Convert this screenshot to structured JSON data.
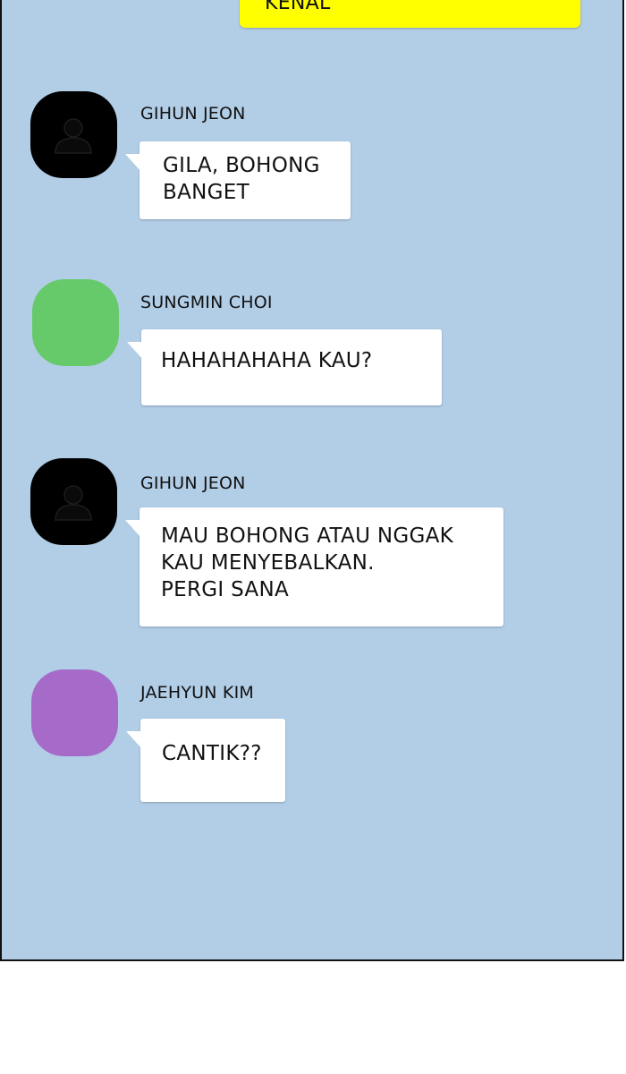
{
  "chat": {
    "own_message": {
      "text": "KENAL",
      "color": "#ffff00"
    },
    "messages": [
      {
        "sender": "GIHUN JEON",
        "avatar_color": "#000000",
        "avatar_icon": "person-icon",
        "text": "GILA, BOHONG\nBANGET"
      },
      {
        "sender": "SUNGMIN CHOI",
        "avatar_color": "#66c96a",
        "text": "HAHAHAHAHA KAU?"
      },
      {
        "sender": "GIHUN JEON",
        "avatar_color": "#000000",
        "avatar_icon": "person-icon",
        "text": "MAU BOHONG ATAU NGGAK\nKAU MENYEBALKAN.\nPERGI SANA"
      },
      {
        "sender": "JAEHYUN KIM",
        "avatar_color": "#a66bc9",
        "text": "CANTIK??"
      }
    ],
    "background_color": "#b2cde6"
  }
}
